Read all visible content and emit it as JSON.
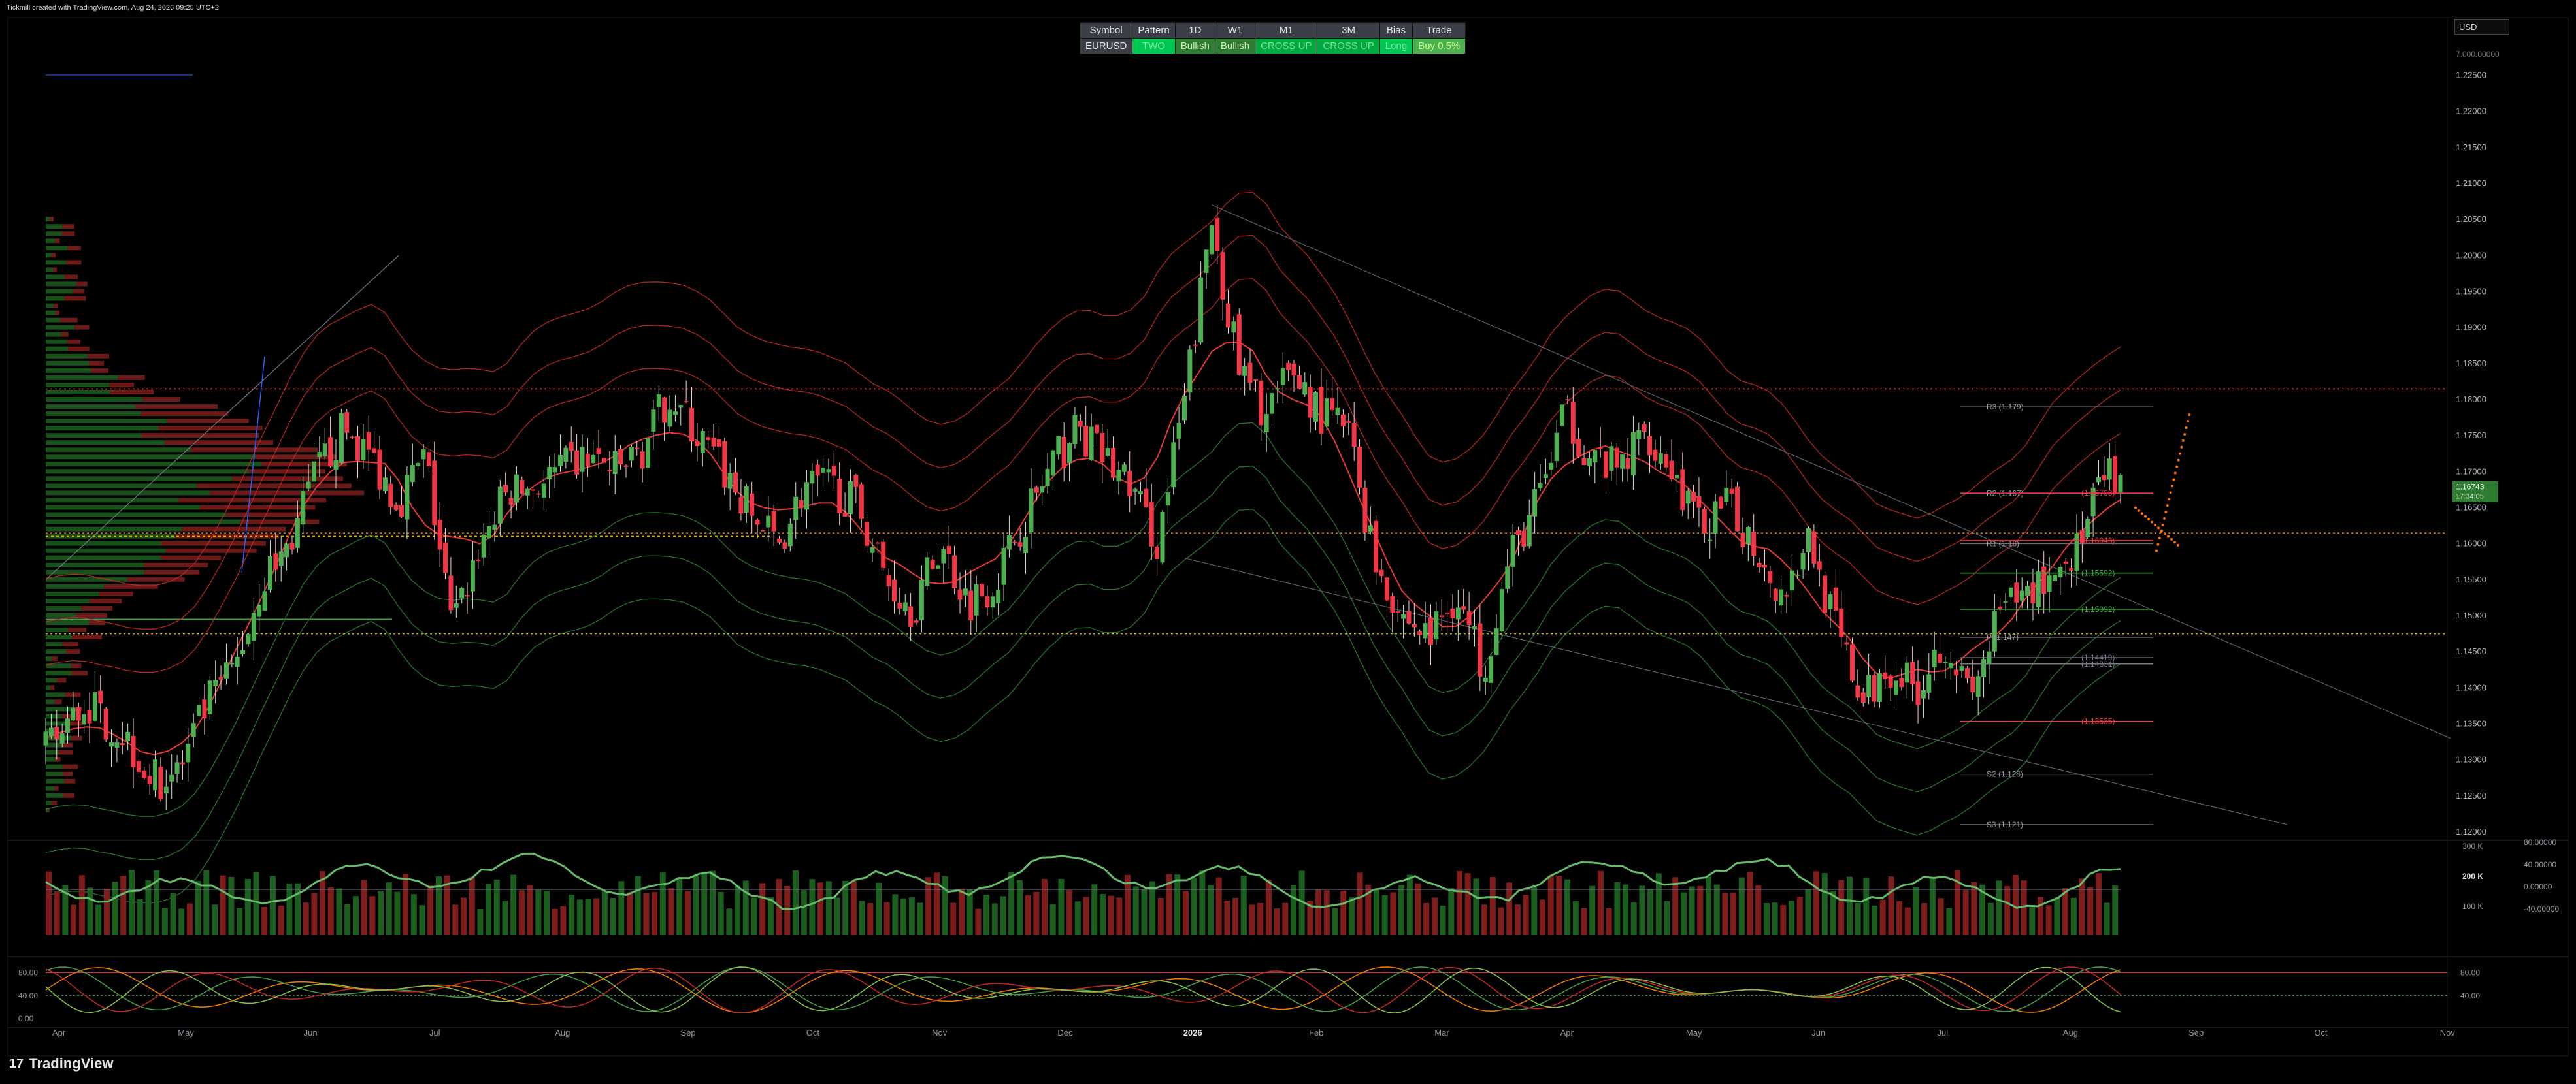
{
  "header": {
    "text": "Tickmill created with TradingView.com, Aug 24, 2026 09:25 UTC+2"
  },
  "brand": {
    "logo": "17",
    "name": "TradingView"
  },
  "currency": {
    "label": "USD"
  },
  "table": {
    "headers": [
      "Symbol",
      "Pattern",
      "1D",
      "W1",
      "M1",
      "3M",
      "Bias",
      "Trade"
    ],
    "row": [
      "EURUSD",
      "TWO",
      "Bullish",
      "Bullish",
      "CROSS UP",
      "CROSS UP",
      "Long",
      "Buy 0.5%"
    ]
  },
  "colors": {
    "up": "#4caf50",
    "down": "#f23645",
    "background": "#000000",
    "envelope_red": "#c62828",
    "envelope_green": "#2e7d32",
    "label_green": "#26a69a"
  },
  "chart_data": [
    {
      "type": "candlestick",
      "symbol": "EURUSD",
      "y_ticks": [
        "7.000.00000",
        "1.22500",
        "1.22000",
        "1.21500",
        "1.21000",
        "1.20500",
        "1.20000",
        "1.19500",
        "1.19000",
        "1.18500",
        "1.18000",
        "1.17500",
        "1.17000",
        "1.16500",
        "1.16000",
        "1.15500",
        "1.15000",
        "1.14500",
        "1.14000",
        "1.13500",
        "1.13000",
        "1.12500",
        "1.12000"
      ],
      "ylim": [
        1.119,
        1.2255
      ],
      "x_ticks": [
        "Apr",
        "May",
        "Jun",
        "Jul",
        "Aug",
        "Sep",
        "Oct",
        "Nov",
        "Dec",
        "2026",
        "Feb",
        "Mar",
        "Apr",
        "May",
        "Jun",
        "Jul",
        "Aug",
        "Sep",
        "Oct",
        "Nov"
      ],
      "price_path": [
        [
          0,
          1.131
        ],
        [
          1.5,
          1.138
        ],
        [
          3,
          1.133
        ],
        [
          4,
          1.127
        ],
        [
          5,
          1.129
        ],
        [
          6,
          1.138
        ],
        [
          7,
          1.143
        ],
        [
          8,
          1.155
        ],
        [
          9,
          1.16
        ],
        [
          10,
          1.17
        ],
        [
          11,
          1.176
        ],
        [
          12,
          1.172
        ],
        [
          13,
          1.166
        ],
        [
          14,
          1.172
        ],
        [
          15,
          1.148
        ],
        [
          16,
          1.16
        ],
        [
          17,
          1.167
        ],
        [
          18,
          1.168
        ],
        [
          19,
          1.17
        ],
        [
          20,
          1.172
        ],
        [
          21,
          1.17
        ],
        [
          22,
          1.173
        ],
        [
          23,
          1.181
        ],
        [
          24,
          1.175
        ],
        [
          25,
          1.17
        ],
        [
          26,
          1.164
        ],
        [
          27,
          1.16
        ],
        [
          28,
          1.168
        ],
        [
          29,
          1.168
        ],
        [
          30,
          1.165
        ],
        [
          31,
          1.155
        ],
        [
          32,
          1.151
        ],
        [
          33,
          1.16
        ],
        [
          34,
          1.152
        ],
        [
          35,
          1.155
        ],
        [
          36,
          1.163
        ],
        [
          37,
          1.17
        ],
        [
          38,
          1.176
        ],
        [
          39,
          1.172
        ],
        [
          40,
          1.168
        ],
        [
          41,
          1.16
        ],
        [
          42,
          1.18
        ],
        [
          43,
          1.205
        ],
        [
          44,
          1.184
        ],
        [
          45,
          1.178
        ],
        [
          46,
          1.184
        ],
        [
          47,
          1.178
        ],
        [
          48,
          1.176
        ],
        [
          49,
          1.158
        ],
        [
          50,
          1.15
        ],
        [
          51,
          1.147
        ],
        [
          52,
          1.153
        ],
        [
          53,
          1.143
        ],
        [
          54,
          1.158
        ],
        [
          55,
          1.166
        ],
        [
          56,
          1.178
        ],
        [
          57,
          1.172
        ],
        [
          58,
          1.17
        ],
        [
          59,
          1.176
        ],
        [
          60,
          1.17
        ],
        [
          61,
          1.162
        ],
        [
          62,
          1.165
        ],
        [
          63,
          1.16
        ],
        [
          64,
          1.153
        ],
        [
          65,
          1.161
        ],
        [
          66,
          1.148
        ],
        [
          67,
          1.138
        ],
        [
          68,
          1.143
        ],
        [
          69,
          1.14
        ],
        [
          70,
          1.147
        ],
        [
          71,
          1.138
        ],
        [
          72,
          1.15
        ],
        [
          73,
          1.153
        ],
        [
          74,
          1.156
        ],
        [
          75,
          1.16
        ],
        [
          76,
          1.17
        ],
        [
          76.5,
          1.167
        ]
      ],
      "pivot_levels": [
        {
          "label": "R3 (1.179)",
          "value": 1.179
        },
        {
          "label": "R2 (1.167)",
          "value": 1.167
        },
        {
          "label": "R1 (1.16)",
          "value": 1.16
        },
        {
          "label": "P (1.147)",
          "value": 1.147
        },
        {
          "label": "S2 (1.128)",
          "value": 1.128
        },
        {
          "label": "S3 (1.121)",
          "value": 1.121
        }
      ],
      "level_labels": [
        "(1.16703)",
        "(1.16043)",
        "(1.15592)",
        "(1.14419)",
        "(1.14331)",
        "(1.13535)",
        "(1.15092)"
      ],
      "horizontal_lines": [
        1.1815,
        1.1615,
        1.1475
      ],
      "last_price": {
        "value": "1.16743",
        "change": "17:34:05"
      }
    },
    {
      "type": "bar",
      "name": "Volume",
      "y_ticks": [
        "300 K",
        "200 K",
        "100 K"
      ],
      "right_ticks": [
        "80.00000",
        "40.00000",
        "0.00000",
        "-40.00000"
      ]
    },
    {
      "type": "line",
      "name": "Stochastic",
      "left_ticks": [
        "80.00",
        "40.00",
        "0.00"
      ],
      "right_ticks": [
        "80.00",
        "40.00"
      ]
    }
  ]
}
